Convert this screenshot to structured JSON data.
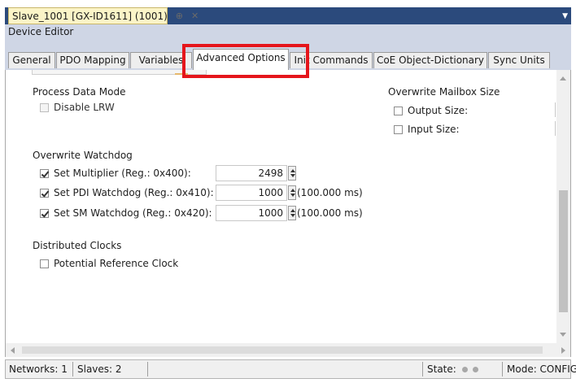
{
  "document_tab": {
    "title": "Slave_1001 [GX-ID1611] (1001)",
    "pin_icon": "pin-icon",
    "close_icon": "close-icon"
  },
  "editor_title": "Device Editor",
  "tabs": [
    {
      "label": "General",
      "active": false
    },
    {
      "label": "PDO Mapping",
      "active": false
    },
    {
      "label": "Variables",
      "active": false
    },
    {
      "label": "Advanced Options",
      "active": true
    },
    {
      "label": "Init Commands",
      "active": false
    },
    {
      "label": "CoE Object-Dictionary",
      "active": false
    },
    {
      "label": "Sync Units",
      "active": false
    }
  ],
  "process_data_mode": {
    "title": "Process Data Mode",
    "disable_lrw": {
      "label": "Disable LRW",
      "checked": false,
      "enabled": false
    }
  },
  "overwrite_mailbox": {
    "title": "Overwrite Mailbox Size",
    "output_size": {
      "label": "Output Size:",
      "checked": false
    },
    "input_size": {
      "label": "Input Size:",
      "checked": false
    }
  },
  "overwrite_watchdog": {
    "title": "Overwrite Watchdog",
    "multiplier": {
      "label": "Set Multiplier (Reg.: 0x400):",
      "checked": true,
      "value": "2498"
    },
    "pdi": {
      "label": "Set PDI Watchdog (Reg.: 0x410):",
      "checked": true,
      "value": "1000",
      "unit": "(100.000 ms)"
    },
    "sm": {
      "label": "Set SM Watchdog (Reg.: 0x420):",
      "checked": true,
      "value": "1000",
      "unit": "(100.000 ms)"
    }
  },
  "distributed_clocks": {
    "title": "Distributed Clocks",
    "potential_reference": {
      "label": "Potential Reference Clock",
      "checked": false
    }
  },
  "status_bar": {
    "networks": "Networks: 1",
    "slaves": "Slaves: 2",
    "state_label": "State:",
    "mode": "Mode: CONFIG"
  },
  "colors": {
    "highlight": "#e5151b",
    "tab_bar": "#2b4a7c",
    "doc_tab": "#fbf4c7"
  }
}
